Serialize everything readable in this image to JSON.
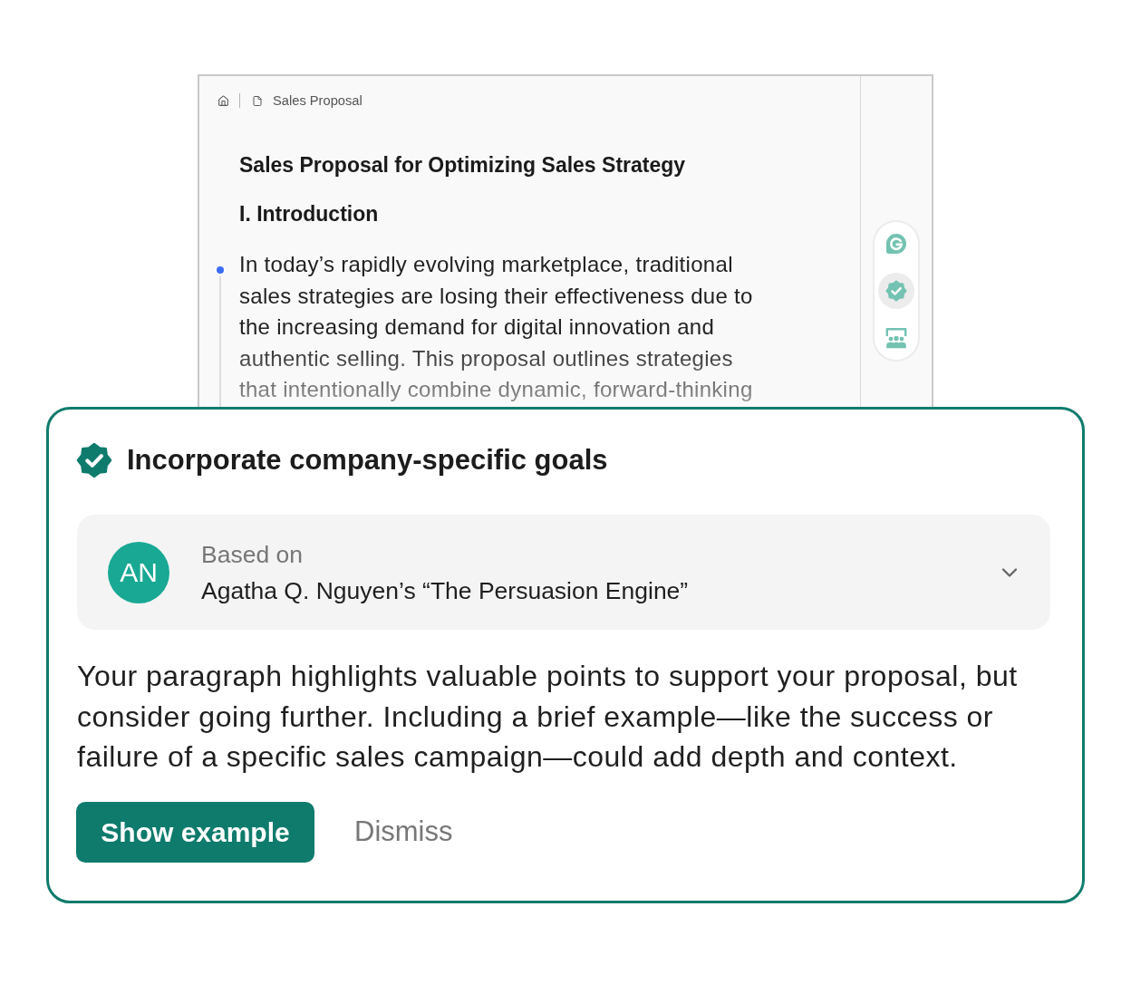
{
  "document": {
    "breadcrumb": {
      "title": "Sales Proposal"
    },
    "heading": "Sales Proposal for Optimizing Sales Strategy",
    "section": "I. Introduction",
    "paragraph": "In today’s rapidly evolving marketplace, traditional sales strategies are losing their effectiveness due to the increasing demand for digital innovation and authentic selling. This proposal outlines strategies that intentionally combine dynamic, forward-thinking"
  },
  "rail": {
    "items": [
      {
        "kind": "logo",
        "selected": false
      },
      {
        "kind": "badge",
        "selected": true
      },
      {
        "kind": "people",
        "selected": false
      }
    ]
  },
  "suggestion": {
    "title": "Incorporate company-specific goals",
    "source": {
      "avatar": "AN",
      "label": "Based on",
      "name": "Agatha Q. Nguyen’s “The Persuasion Engine”",
      "expanded": false
    },
    "body": "Your paragraph highlights valuable points to support your proposal, but consider going further. Including a brief example—like the success or failure of a specific sales campaign—could add depth and context.",
    "actions": [
      {
        "label": "Show example",
        "kind": "primary"
      },
      {
        "label": "Dismiss",
        "kind": "secondary"
      }
    ]
  }
}
